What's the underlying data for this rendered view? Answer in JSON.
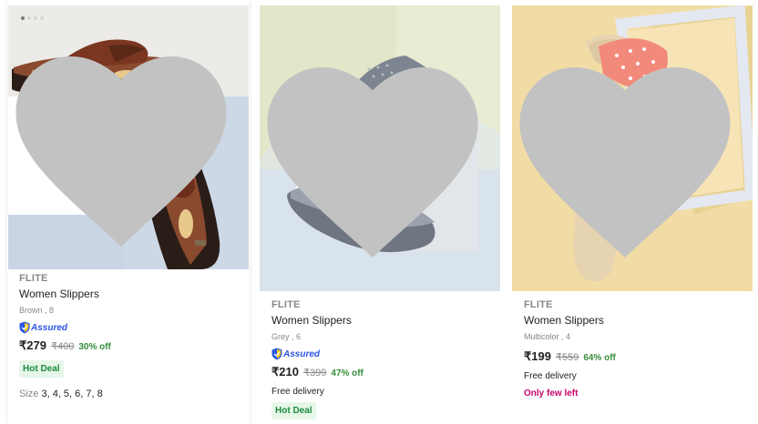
{
  "products": [
    {
      "brand": "FLITE",
      "title": "Women Slippers",
      "variant": "Brown , 8",
      "assured_label": "Assured",
      "price": "₹279",
      "mrp": "₹400",
      "discount": "30% off",
      "hot_deal": "Hot Deal",
      "size_label": "Size",
      "sizes": "3, 4, 5, 6, 7, 8",
      "wishlist_icon": "heart-icon",
      "gallery_dots": 3
    },
    {
      "brand": "FLITE",
      "title": "Women Slippers",
      "variant": "Grey , 6",
      "assured_label": "Assured",
      "price": "₹210",
      "mrp": "₹399",
      "discount": "47% off",
      "delivery": "Free delivery",
      "hot_deal": "Hot Deal",
      "wishlist_icon": "heart-icon"
    },
    {
      "brand": "FLITE",
      "title": "Women Slippers",
      "variant": "Multicolor , 4",
      "price": "₹199",
      "mrp": "₹559",
      "discount": "64% off",
      "delivery": "Free delivery",
      "stock_note": "Only few left",
      "wishlist_icon": "heart-icon"
    }
  ],
  "colors": {
    "price_discount": "#388e3c",
    "assured_blue": "#2a55e5",
    "hot_deal_bg": "#e6f7e9",
    "few_left": "#c7046b",
    "wishlist_heart": "#c2c2c2"
  }
}
